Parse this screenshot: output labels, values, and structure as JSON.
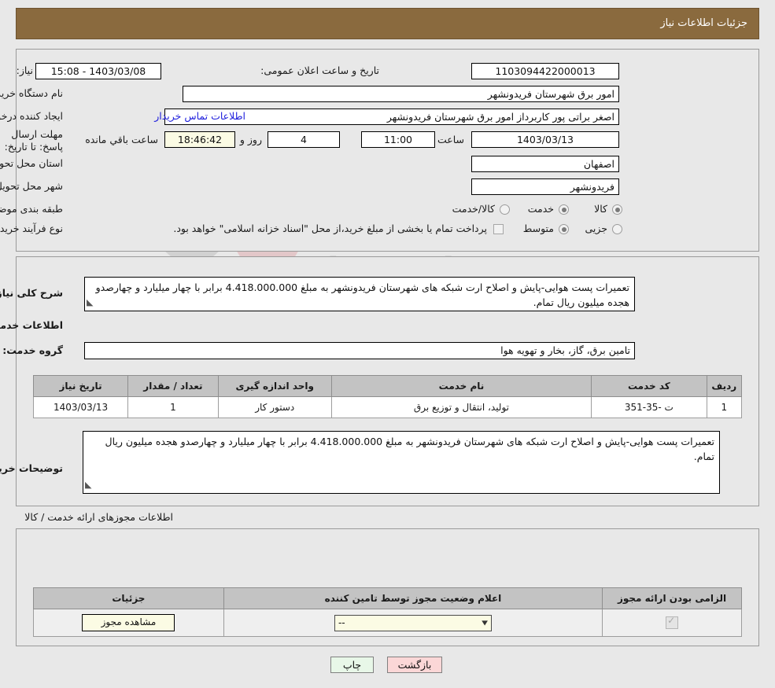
{
  "header": {
    "title": "جزئیات اطلاعات نیاز"
  },
  "watermark": {
    "text": "AriaTender.net"
  },
  "form": {
    "need_number_label": "شماره نیاز:",
    "need_number_value": "1103094422000013",
    "announce_label": "تاریخ و ساعت اعلان عمومی:",
    "announce_value": "1403/03/08 - 15:08",
    "buyer_org_label": "نام دستگاه خریدار:",
    "buyer_org_value": "امور برق شهرستان فریدونشهر",
    "requester_label": "ایجاد کننده درخواست:",
    "requester_value": "اصغر براتی پور کاربرداز امور برق شهرستان فریدونشهر",
    "contact_link": "اطلاعات تماس خریدار",
    "deadline_label": "مهلت ارسال پاسخ: تا تاریخ:",
    "deadline_date": "1403/03/13",
    "hour_label": "ساعت",
    "hour_value": "11:00",
    "days_value": "4",
    "days_label": "روز و",
    "countdown_value": "18:46:42",
    "remaining_label": "ساعت باقي مانده",
    "province_label": "استان محل تحویل:",
    "province_value": "اصفهان",
    "city_label": "شهر محل تحویل:",
    "city_value": "فریدونشهر",
    "category_label": "طبقه بندی موضوعی:",
    "category_options": [
      {
        "label": "کالا",
        "selected": false
      },
      {
        "label": "خدمت",
        "selected": true
      },
      {
        "label": "کالا/خدمت",
        "selected": false
      }
    ],
    "process_label": "نوع فرآیند خرید :",
    "process_options": [
      {
        "label": "جزیی",
        "selected": false
      },
      {
        "label": "متوسط",
        "selected": true
      }
    ],
    "payment_checkbox_checked": false,
    "payment_note": "پرداخت تمام یا بخشی از مبلغ خرید،از محل \"اسناد خزانه اسلامی\" خواهد بود."
  },
  "summary": {
    "label": "شرح کلی نیاز:",
    "text": "تعمیرات پست هوایی-پایش و اصلاح ارت شبکه های شهرستان فریدونشهر به مبلغ 4.418.000.000 برابر با چهار میلیارد و چهارصدو هجده میلیون ریال تمام."
  },
  "services": {
    "section_title": "اطلاعات خدمات مورد نیاز",
    "group_label": "گروه خدمت:",
    "group_value": "تامین برق، گاز، بخار و تهویه هوا",
    "columns": [
      "ردیف",
      "کد خدمت",
      "نام خدمت",
      "واحد اندازه گیری",
      "تعداد / مقدار",
      "تاریخ نیاز"
    ],
    "rows": [
      {
        "row": "1",
        "code": "ت -35-351",
        "name": "تولید، انتقال و توزیع برق",
        "unit": "دستور کار",
        "qty": "1",
        "date": "1403/03/13"
      }
    ]
  },
  "buyer_notes": {
    "label": "توضیحات خریدار:",
    "text": "تعمیرات پست هوایی-پایش و اصلاح ارت شبکه های شهرستان فریدونشهر به مبلغ 4.418.000.000 برابر با چهار میلیارد و چهارصدو هجده میلیون ریال تمام."
  },
  "permits": {
    "section_title": "اطلاعات مجوزهای ارائه خدمت / کالا",
    "columns": [
      "الزامی بودن ارائه مجوز",
      "اعلام وضعیت مجوز توسط تامین کننده",
      "جزئیات"
    ],
    "rows": [
      {
        "required": true,
        "status_value": "--",
        "details_label": "مشاهده مجوز"
      }
    ]
  },
  "footer": {
    "print_label": "چاپ",
    "back_label": "بازگشت"
  }
}
